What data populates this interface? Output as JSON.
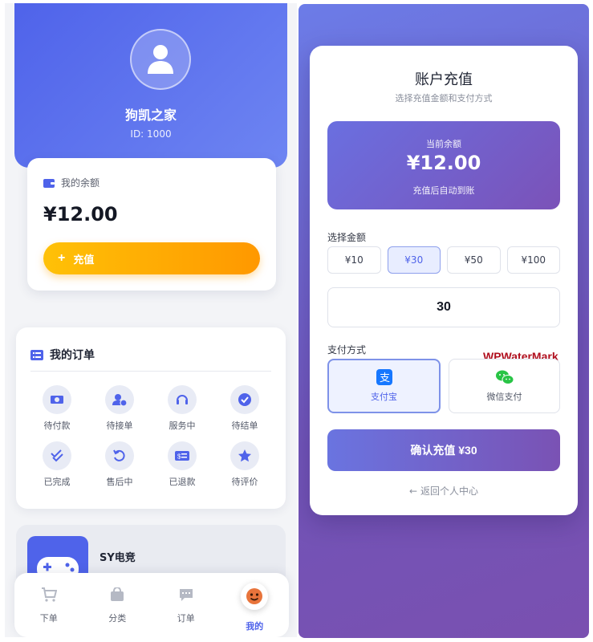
{
  "profile": {
    "name": "狗凯之家",
    "id_label": "ID: 1000"
  },
  "balance_card": {
    "title": "我的余额",
    "amount": "¥12.00",
    "recharge_label": "充值"
  },
  "orders": {
    "title": "我的订单",
    "items": [
      {
        "label": "待付款",
        "icon": "money-icon"
      },
      {
        "label": "待接单",
        "icon": "user-clock-icon"
      },
      {
        "label": "服务中",
        "icon": "headset-icon"
      },
      {
        "label": "待结单",
        "icon": "check-circle-icon"
      },
      {
        "label": "已完成",
        "icon": "double-check-icon"
      },
      {
        "label": "售后中",
        "icon": "undo-icon"
      },
      {
        "label": "已退款",
        "icon": "refund-icon"
      },
      {
        "label": "待评价",
        "icon": "star-icon"
      }
    ]
  },
  "promo": {
    "title": "SY电竞"
  },
  "bottom_nav": {
    "items": [
      {
        "label": "下单",
        "icon": "cart-icon"
      },
      {
        "label": "分类",
        "icon": "bag-icon"
      },
      {
        "label": "订单",
        "icon": "chat-icon"
      },
      {
        "label": "我的",
        "icon": "emoji-avatar-icon",
        "active": true
      }
    ]
  },
  "recharge": {
    "title": "账户充值",
    "subtitle": "选择充值金额和支付方式",
    "balance_label": "当前余额",
    "balance_amount": "¥12.00",
    "balance_note": "充值后自动到账",
    "amount_section": "选择金额",
    "amounts": [
      "¥10",
      "¥30",
      "¥50",
      "¥100"
    ],
    "selected_amount": "¥30",
    "custom_value": "30",
    "pay_section": "支付方式",
    "methods": [
      {
        "label": "支付宝",
        "icon": "alipay-icon",
        "active": true
      },
      {
        "label": "微信支付",
        "icon": "wechat-icon",
        "active": false
      }
    ],
    "confirm_label": "确认充值 ¥30",
    "back_label": "返回个人中心"
  },
  "watermark": "WPWaterMark",
  "colors": {
    "primary": "#4f63ea",
    "recharge_gradient_start": "#ffc107",
    "recharge_gradient_end": "#ff9800",
    "modal_bg_start": "#6c7ce8",
    "modal_bg_end": "#7a50b0",
    "watermark": "#b00f1e"
  }
}
